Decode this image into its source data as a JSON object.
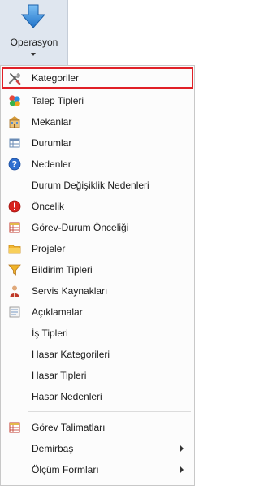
{
  "ribbon": {
    "label": "Operasyon",
    "icon": "blue-down-arrow-icon"
  },
  "menu": {
    "items": [
      {
        "label": "Kategoriler",
        "icon": "tools-icon",
        "selected": true
      },
      {
        "label": "Talep Tipleri",
        "icon": "colored-balls-icon"
      },
      {
        "label": "Mekanlar",
        "icon": "building-icon"
      },
      {
        "label": "Durumlar",
        "icon": "table-list-icon"
      },
      {
        "label": "Nedenler",
        "icon": "help-question-icon"
      },
      {
        "label": "Durum Değişiklik Nedenleri",
        "icon": ""
      },
      {
        "label": "Öncelik",
        "icon": "exclamation-icon"
      },
      {
        "label": "Görev-Durum Önceliği",
        "icon": "grid-list-icon"
      },
      {
        "label": "Projeler",
        "icon": "folder-icon"
      },
      {
        "label": "Bildirim Tipleri",
        "icon": "funnel-icon"
      },
      {
        "label": "Servis Kaynakları",
        "icon": "person-icon"
      },
      {
        "label": "Açıklamalar",
        "icon": "notepad-icon"
      },
      {
        "label": "İş Tipleri",
        "icon": ""
      },
      {
        "label": "Hasar Kategorileri",
        "icon": ""
      },
      {
        "label": "Hasar Tipleri",
        "icon": ""
      },
      {
        "label": "Hasar Nedenleri",
        "icon": ""
      },
      {
        "label": "Görev Talimatları",
        "icon": "grid-list-icon"
      },
      {
        "label": "Demirbaş",
        "icon": "",
        "submenu": true
      },
      {
        "label": "Ölçüm Formları",
        "icon": "",
        "submenu": true
      }
    ]
  }
}
